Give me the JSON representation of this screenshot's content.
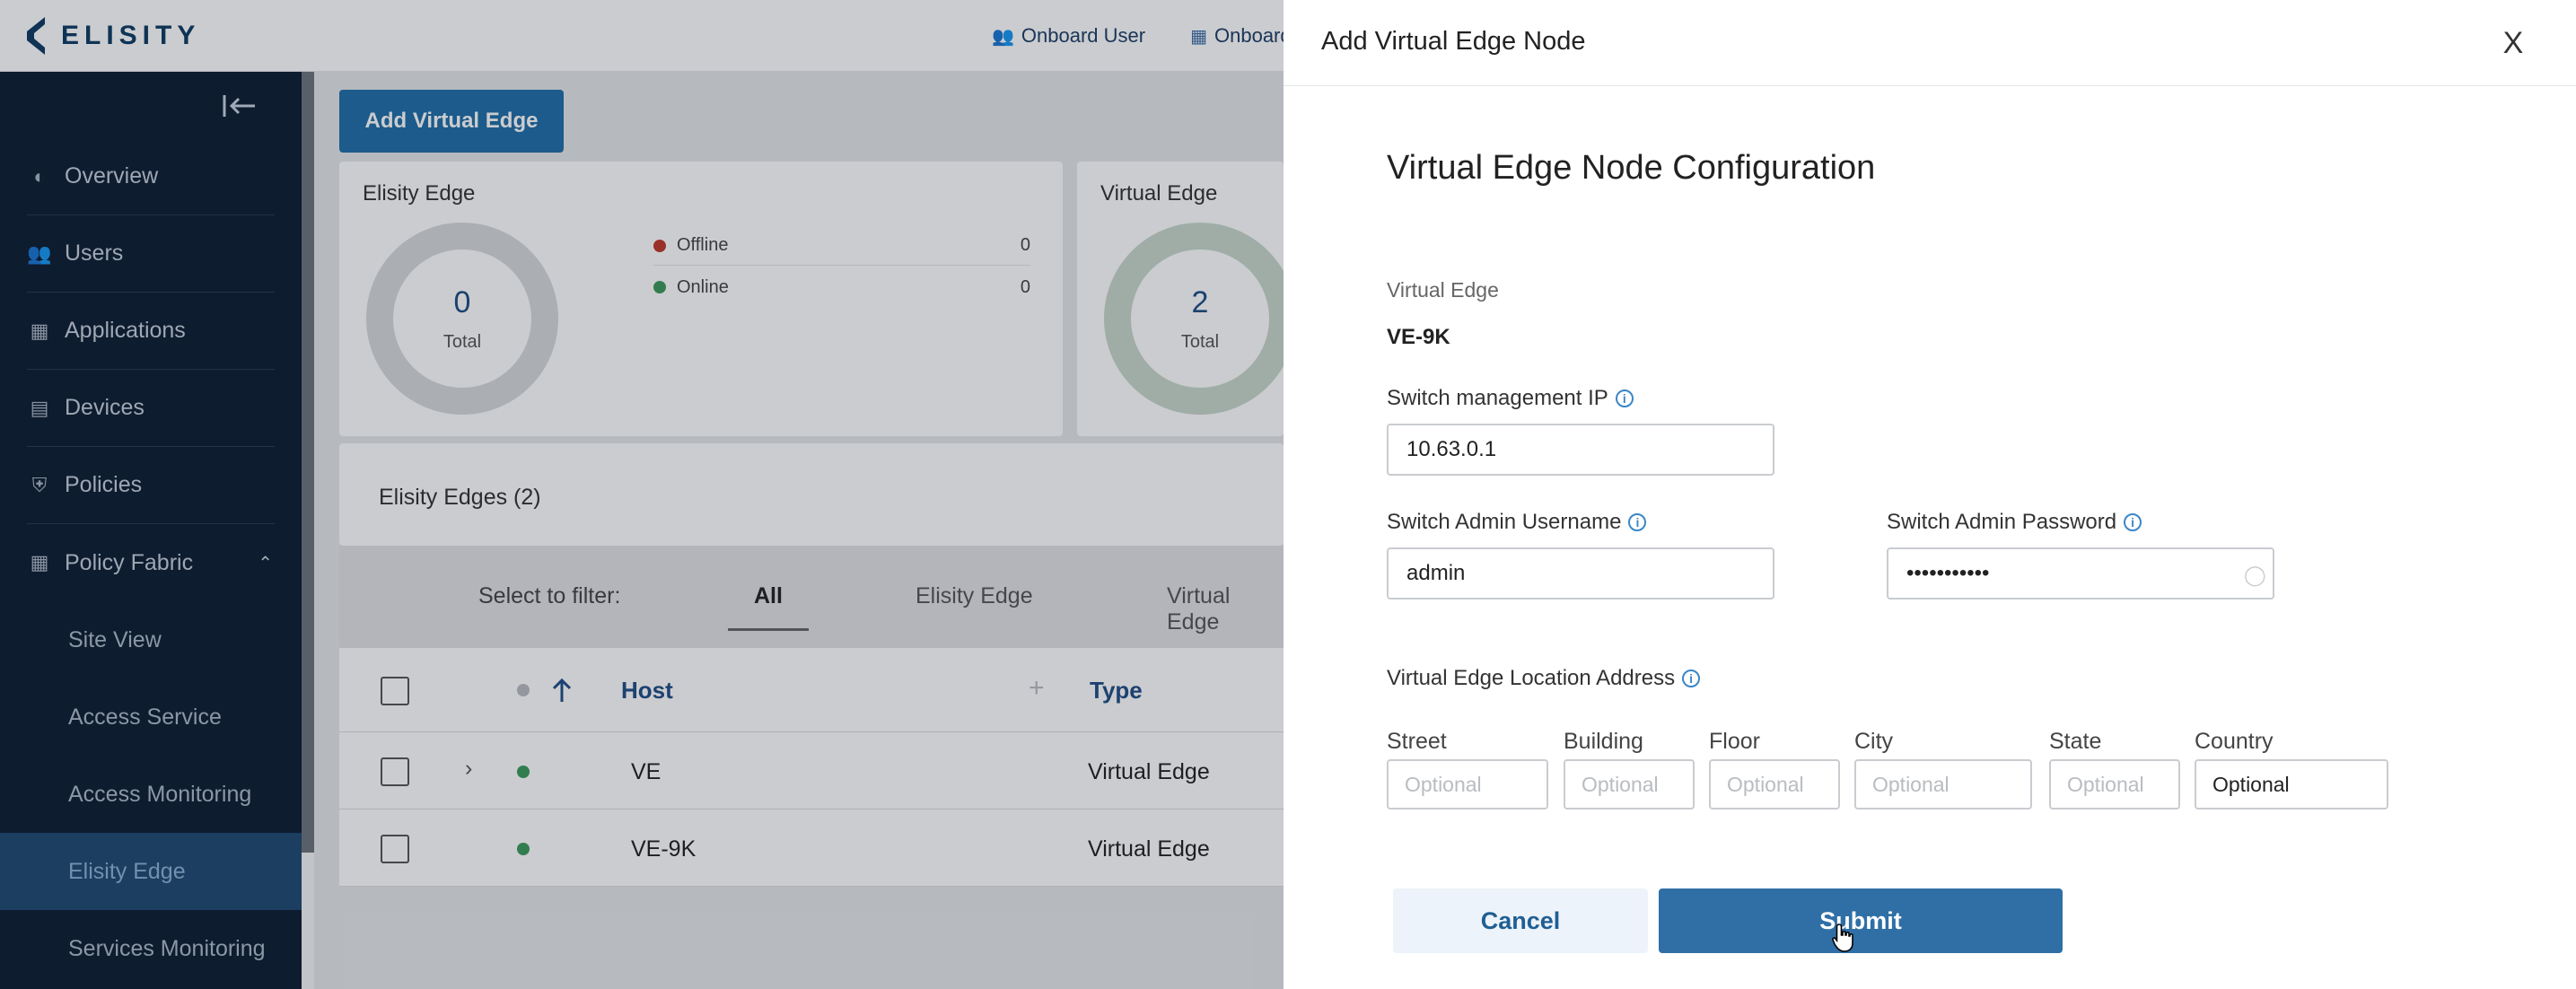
{
  "app": {
    "logo_text": "ELISITY"
  },
  "topbar": {
    "links": [
      "Onboard User",
      "Onboard"
    ]
  },
  "sidebar": {
    "items": [
      {
        "label": "Overview",
        "icon": "dashboard-icon"
      },
      {
        "label": "Users",
        "icon": "users-icon"
      },
      {
        "label": "Applications",
        "icon": "grid-icon"
      },
      {
        "label": "Devices",
        "icon": "devices-icon"
      },
      {
        "label": "Policies",
        "icon": "shield-icon"
      },
      {
        "label": "Policy Fabric",
        "icon": "fabric-icon"
      }
    ],
    "subitems": [
      {
        "label": "Site View"
      },
      {
        "label": "Access Service"
      },
      {
        "label": "Access Monitoring"
      },
      {
        "label": "Elisity Edge",
        "active": true
      },
      {
        "label": "Services Monitoring"
      }
    ]
  },
  "main": {
    "add_button": "Add Virtual Edge",
    "elisity_card": {
      "title": "Elisity Edge",
      "total_value": "0",
      "total_label": "Total",
      "legend": [
        {
          "label": "Offline",
          "count": "0",
          "color": "#c0392b"
        },
        {
          "label": "Online",
          "count": "0",
          "color": "#3c9a5c"
        }
      ]
    },
    "virtual_card": {
      "title": "Virtual Edge",
      "total_value": "2",
      "total_label": "Total"
    },
    "section_title": "Elisity Edges (2)",
    "filter": {
      "label": "Select to filter:",
      "tabs": [
        "All",
        "Elisity Edge",
        "Virtual Edge"
      ]
    },
    "table": {
      "headers": {
        "host": "Host",
        "add": "+",
        "type": "Type"
      },
      "rows": [
        {
          "host": "VE",
          "type": "Virtual Edge"
        },
        {
          "host": "VE-9K",
          "type": "Virtual Edge"
        }
      ]
    }
  },
  "drawer": {
    "title": "Add Virtual Edge Node",
    "close": "X",
    "config_title": "Virtual Edge Node Configuration",
    "virtual_edge_label": "Virtual Edge",
    "virtual_edge_value": "VE-9K",
    "switch_ip_label": "Switch management IP",
    "switch_ip_value": "10.63.0.1",
    "username_label": "Switch Admin Username",
    "username_value": "admin",
    "password_label": "Switch Admin Password",
    "password_value": "•••••••••••",
    "address_label": "Virtual Edge Location Address",
    "address_fields": [
      {
        "label": "Street",
        "placeholder": "Optional",
        "value": ""
      },
      {
        "label": "Building",
        "placeholder": "Optional",
        "value": ""
      },
      {
        "label": "Floor",
        "placeholder": "Optional",
        "value": ""
      },
      {
        "label": "City",
        "placeholder": "Optional",
        "value": ""
      },
      {
        "label": "State",
        "placeholder": "Optional",
        "value": ""
      },
      {
        "label": "Country",
        "placeholder": "Optional",
        "value": "Optional"
      }
    ],
    "cancel": "Cancel",
    "submit": "Submit"
  }
}
